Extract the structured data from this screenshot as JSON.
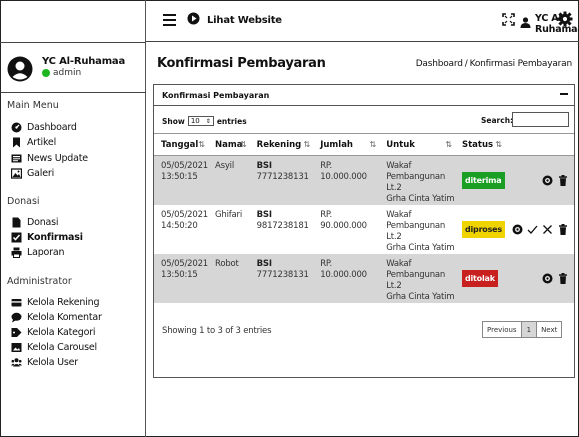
{
  "topbar": {
    "web_link_label": "Lihat Website",
    "user_label": "YC Al-Ruhamaa"
  },
  "profile": {
    "name": "YC Al-Ruhamaa",
    "role": "admin",
    "status_color": "#1db520"
  },
  "sidebar": {
    "sections": [
      {
        "title": "Main Menu",
        "items": [
          {
            "label": "Dashboard",
            "icon": "dashboard-icon"
          },
          {
            "label": "Artikel",
            "icon": "bookmark-icon"
          },
          {
            "label": "News Update",
            "icon": "newspaper-icon"
          },
          {
            "label": "Galeri",
            "icon": "image-icon"
          }
        ]
      },
      {
        "title": "Donasi",
        "items": [
          {
            "label": "Donasi",
            "icon": "document-icon"
          },
          {
            "label": "Konfirmasi",
            "icon": "checkbox-icon",
            "active": true
          },
          {
            "label": "Laporan",
            "icon": "print-icon"
          }
        ]
      },
      {
        "title": "Administrator",
        "items": [
          {
            "label": "Kelola Rekening",
            "icon": "wallet-icon"
          },
          {
            "label": "Kelola Komentar",
            "icon": "comment-icon"
          },
          {
            "label": "Kelola Kategori",
            "icon": "tag-icon"
          },
          {
            "label": "Kelola Carousel",
            "icon": "photo-icon"
          },
          {
            "label": "Kelola User",
            "icon": "users-icon"
          }
        ]
      }
    ]
  },
  "page": {
    "title": "Konfirmasi Pembayaran",
    "breadcrumb_home": "Dashboard",
    "breadcrumb_sep": "/",
    "breadcrumb_current": "Konfirmasi Pembayaran"
  },
  "card": {
    "title": "Konfirmasi Pembayaran",
    "show_label": "Show",
    "show_value": "10",
    "entries_label": "entries",
    "search_label": "Search:",
    "search_value": ""
  },
  "table": {
    "columns": [
      "Tanggal",
      "Nama",
      "Rekening",
      "Jumlah",
      "Untuk",
      "Status"
    ],
    "rows": [
      {
        "date": "05/05/2021",
        "time": "13:50:15",
        "name": "Asyil",
        "bank": "BSI",
        "account": "7771238131",
        "amount": "RP. 10.000.000",
        "purpose": [
          "Wakaf",
          "Pembangunan Lt.2",
          "Grha Cinta Yatim"
        ],
        "status": "diterima",
        "status_color": "#1a9e24"
      },
      {
        "date": "05/05/2021",
        "time": "14:50:20",
        "name": "Ghifari",
        "bank": "BSI",
        "account": "9817238181",
        "amount": "RP. 90.000.000",
        "purpose": [
          "Wakaf",
          "Pembangunan Lt.2",
          "Grha Cinta Yatim"
        ],
        "status": "diproses",
        "status_color": "#f0d400"
      },
      {
        "date": "05/05/2021",
        "time": "13:50:15",
        "name": "Robot",
        "bank": "BSI",
        "account": "7771238131",
        "amount": "RP. 10.000.000",
        "purpose": [
          "Wakaf",
          "Pembangunan Lt.2",
          "Grha Cinta Yatim"
        ],
        "status": "ditolak",
        "status_color": "#c81f1f"
      }
    ]
  },
  "footer": {
    "showing_text": "Showing 1 to 3 of 3 entries",
    "prev_label": "Previous",
    "current_page": "1",
    "next_label": "Next"
  }
}
